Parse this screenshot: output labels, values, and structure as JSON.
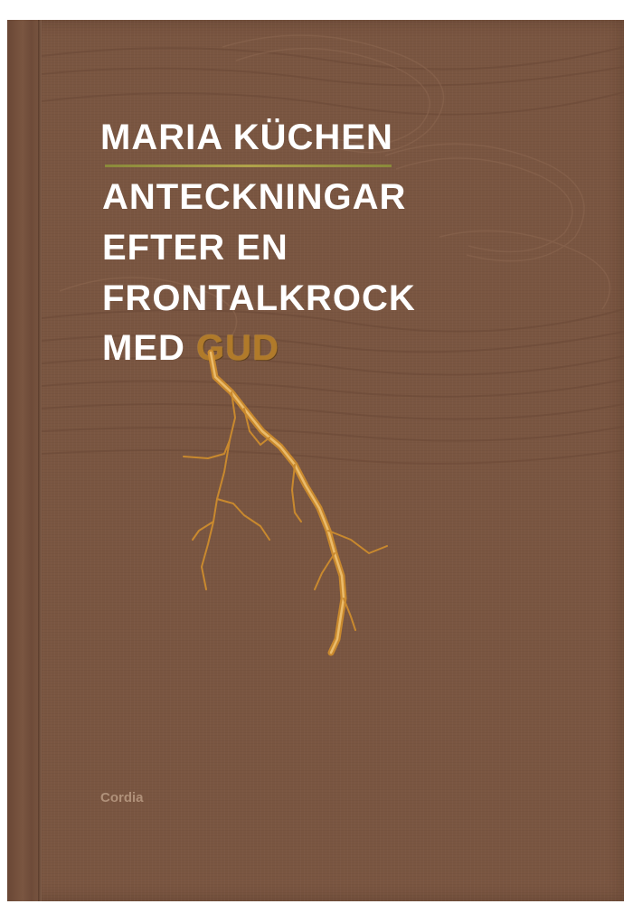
{
  "cover": {
    "author": "MARIA KÜCHEN",
    "title_lines": [
      "ANTECKNINGAR",
      "EFTER EN",
      "FRONTALKROCK",
      "MED"
    ],
    "title_highlight": "GUD",
    "publisher": "Cordia"
  },
  "colors": {
    "board": "#7a5641",
    "text": "#ffffff",
    "gold": "#c9892e",
    "rule": "#a89a44"
  },
  "icons": {
    "illustration": "engraved-clouds",
    "lightning": "lightning-bolt"
  }
}
